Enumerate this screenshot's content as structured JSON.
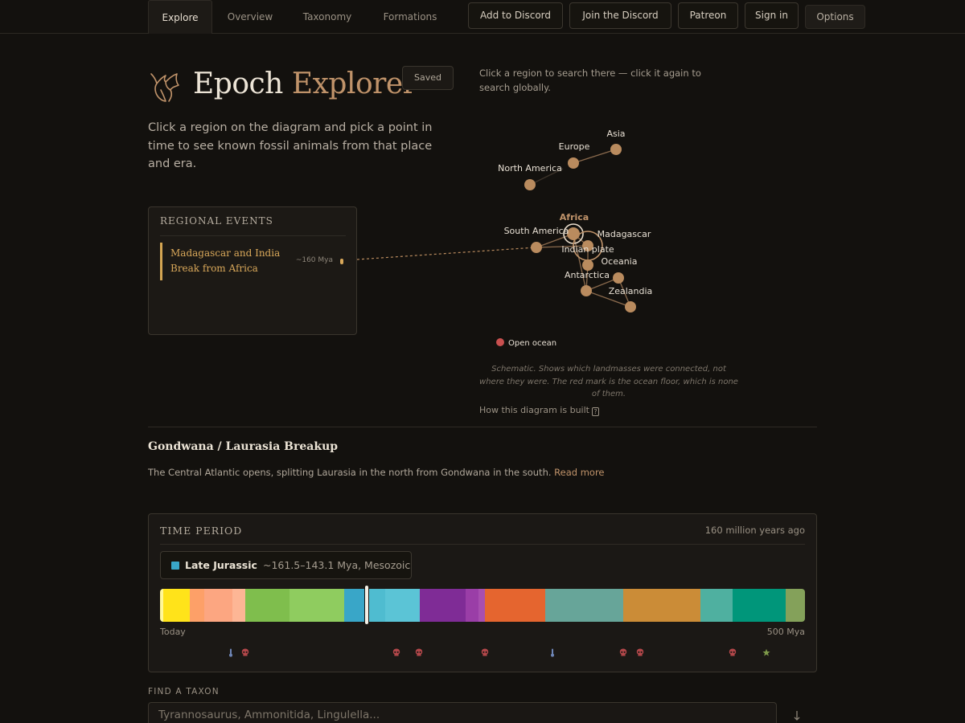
{
  "nav": {
    "tabs": [
      "Explore",
      "Overview",
      "Taxonomy",
      "Formations"
    ],
    "active_tab": "Explore",
    "buttons": [
      "Add to Discord",
      "Join the Discord",
      "Patreon",
      "Sign in"
    ],
    "options_label": "Options"
  },
  "header": {
    "title_main": "Epoch",
    "title_accent": "Explorer",
    "saved_label": "Saved",
    "intro": "Click a region on the diagram and pick a point in time to see known fossil animals from that place and era."
  },
  "events": {
    "heading": "REGIONAL EVENTS",
    "items": [
      {
        "title": "Madagascar and India Break from Africa",
        "time": "~160 Mya"
      }
    ]
  },
  "diagram": {
    "hint": "Click a region to search there — click it again to search globally.",
    "regions": {
      "asia": "Asia",
      "europe": "Europe",
      "north_america": "North America",
      "africa": "Africa",
      "south_america": "South America",
      "madagascar": "Madagascar",
      "indian_plate": "Indian plate",
      "oceania": "Oceania",
      "antarctica": "Antarctica",
      "zealandia": "Zealandia"
    },
    "selected_region": "Africa",
    "ocean_label": "Open ocean",
    "caption": "Schematic. Shows which landmasses were connected, not where they were. The red mark is the ocean floor, which is none of them.",
    "how_link": "How this diagram is built",
    "colors": {
      "node": "#b98b5e",
      "selected": "#c0936a",
      "ocean": "#c9504f",
      "edge": "#8a6a4d"
    }
  },
  "era": {
    "title": "Gondwana / Laurasia Breakup",
    "description": "The Central Atlantic opens, splitting Laurasia in the north from Gondwana in the south.",
    "read_more": "Read more"
  },
  "time_period": {
    "heading": "TIME PERIOD",
    "ago": "160 million years ago",
    "period_name": "Late Jurassic",
    "period_range": "~161.5–143.1 Mya, Mesozoic",
    "period_color": "#39a6c8",
    "start_label": "Today",
    "end_label": "500 Mya",
    "selected_mya": 160,
    "max_mya": 500,
    "segments": [
      {
        "from": 0,
        "to": 2.6,
        "color": "#fff799"
      },
      {
        "from": 2.6,
        "to": 23,
        "color": "#ffe31a"
      },
      {
        "from": 23,
        "to": 34,
        "color": "#fda068"
      },
      {
        "from": 34,
        "to": 56,
        "color": "#fca681"
      },
      {
        "from": 56,
        "to": 66,
        "color": "#fdb695"
      },
      {
        "from": 66,
        "to": 100.5,
        "color": "#7fbe4d"
      },
      {
        "from": 100.5,
        "to": 143.1,
        "color": "#8fcc5f"
      },
      {
        "from": 143.1,
        "to": 161.5,
        "color": "#39a6c8"
      },
      {
        "from": 161.5,
        "to": 174.7,
        "color": "#4fbcd0"
      },
      {
        "from": 174.7,
        "to": 201.4,
        "color": "#5bc4d6"
      },
      {
        "from": 201.4,
        "to": 237,
        "color": "#7f2c96"
      },
      {
        "from": 237,
        "to": 247.2,
        "color": "#9a3ea7"
      },
      {
        "from": 247.2,
        "to": 251.9,
        "color": "#a84fb0"
      },
      {
        "from": 251.9,
        "to": 298.9,
        "color": "#e5652f"
      },
      {
        "from": 298.9,
        "to": 358.9,
        "color": "#67a599"
      },
      {
        "from": 358.9,
        "to": 419.2,
        "color": "#cb8c37"
      },
      {
        "from": 419.2,
        "to": 443.8,
        "color": "#4fb0a0"
      },
      {
        "from": 443.8,
        "to": 485.4,
        "color": "#00967a"
      },
      {
        "from": 485.4,
        "to": 500,
        "color": "#84a15a"
      }
    ],
    "markers": [
      {
        "mya": 55,
        "kind": "thermometer-icon",
        "color": "#6f86b7"
      },
      {
        "mya": 66,
        "kind": "skull-icon",
        "color": "#b3474a"
      },
      {
        "mya": 183,
        "kind": "skull-icon",
        "color": "#b3474a"
      },
      {
        "mya": 201,
        "kind": "skull-icon",
        "color": "#b3474a"
      },
      {
        "mya": 252,
        "kind": "skull-icon",
        "color": "#b3474a"
      },
      {
        "mya": 304,
        "kind": "thermometer-icon",
        "color": "#6f86b7"
      },
      {
        "mya": 359,
        "kind": "skull-icon",
        "color": "#b3474a"
      },
      {
        "mya": 372,
        "kind": "skull-icon",
        "color": "#b3474a"
      },
      {
        "mya": 444,
        "kind": "skull-icon",
        "color": "#b3474a"
      },
      {
        "mya": 470,
        "kind": "star-icon",
        "color": "#7e9a4a"
      }
    ]
  },
  "find": {
    "heading": "FIND A TAXON",
    "placeholder": "Tyrannosaurus, Ammonitida, Lingulella..."
  }
}
